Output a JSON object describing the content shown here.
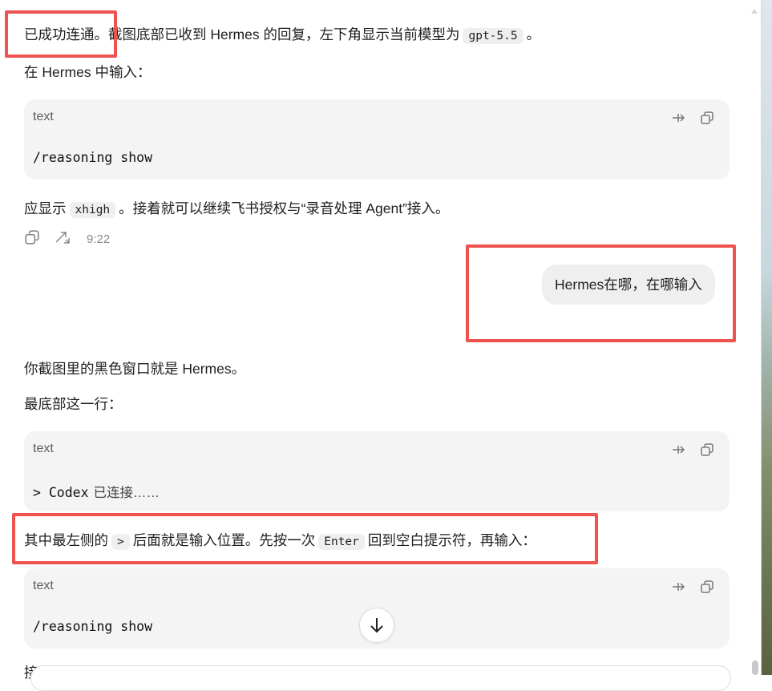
{
  "messages": {
    "p1_pre": "已成功连通。截图底部已收到 Hermes 的回复，左下角显示当前模型为",
    "p1_code": "gpt-5.5",
    "p1_post": "。",
    "p2": "在 Hermes 中输入：",
    "block1": {
      "lang": "text",
      "code": "/reasoning show"
    },
    "p3_pre": "应显示",
    "p3_code": "xhigh",
    "p3_post": "。接着就可以继续飞书授权与“录音处理 Agent”接入。",
    "meta_time": "9:22",
    "user_message": "Hermes在哪，在哪输入",
    "p4": "你截图里的黑色窗口就是 Hermes。",
    "p5": "最底部这一行：",
    "block2": {
      "lang": "text",
      "code": "> Codex",
      "note": "已连接……"
    },
    "p6_pre": "其中最左侧的",
    "p6_code1": ">",
    "p6_mid": "后面就是输入位置。先按一次",
    "p6_code2": "Enter",
    "p6_post": "回到空白提示符，再输入：",
    "block3": {
      "lang": "text",
      "code": "/reasoning show"
    },
    "cut_text": "接"
  },
  "colors": {
    "highlight": "#ef5350",
    "bubble": "#efefef",
    "codeblock": "#f4f4f4"
  },
  "icons": [
    "wrap-icon",
    "copy-icon",
    "share-icon",
    "arrow-down-icon"
  ]
}
